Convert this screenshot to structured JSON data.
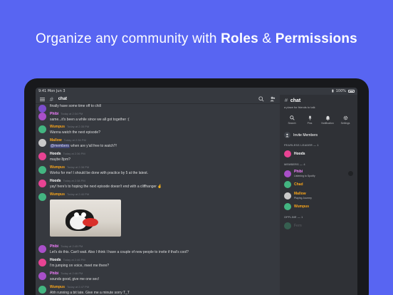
{
  "headline": {
    "prefix": "Organize any community with ",
    "roles": "Roles",
    "amp": " & ",
    "permissions": "Permissions"
  },
  "status_bar": {
    "time": "9:41",
    "date": "Mon Jun 3",
    "battery": "100%"
  },
  "chat": {
    "channel": "chat",
    "messages": [
      {
        "author": "",
        "color": "#dcddde",
        "timestamp": "",
        "lines": [
          "finally have some time off to chill"
        ]
      },
      {
        "author": "Phibi",
        "color": "#f47fff",
        "timestamp": "Today at 2:34 PM",
        "lines": [
          "same...it's been a while since we all got together :("
        ]
      },
      {
        "author": "Wumpus",
        "color": "#faa61a",
        "timestamp": "Today at 2:35 PM",
        "lines": [
          "Wanna watch the next episode?"
        ]
      },
      {
        "author": "Mallow",
        "color": "#faa61a",
        "timestamp": "Today at 2:36 PM",
        "mention": "@members",
        "lines": [
          " when are y'all free to watch?!"
        ]
      },
      {
        "author": "Hoods",
        "color": "#ffffff",
        "timestamp": "Today at 2:36 PM",
        "lines": [
          "maybe 8pm?"
        ]
      },
      {
        "author": "Wumpus",
        "color": "#faa61a",
        "timestamp": "Today at 2:38 PM",
        "lines": [
          "Works for me! I should be done with practice by 5 at the latest."
        ]
      },
      {
        "author": "Hoods",
        "color": "#ffffff",
        "timestamp": "Today at 2:38 PM",
        "lines": [
          "yay! here's to hoping the next episode doesn't end with a cliffhanger 🤞"
        ]
      },
      {
        "author": "Wumpus",
        "color": "#faa61a",
        "timestamp": "Today at 2:40 PM",
        "lines": []
      },
      {
        "author": "Phibi",
        "color": "#f47fff",
        "timestamp": "Today at 2:45 PM",
        "lines": [
          "Let's do this. Can't wait. Also I think I have a couple of new people to invite if that's cool?"
        ]
      },
      {
        "author": "Hoods",
        "color": "#ffffff",
        "timestamp": "Today at 2:46 PM",
        "lines": [
          "I'm jumping on voice, meet me there?"
        ]
      },
      {
        "author": "Phibi",
        "color": "#f47fff",
        "timestamp": "Today at 2:46 PM",
        "lines": [
          "sounds good, give me one sec!"
        ]
      },
      {
        "author": "Wumpus",
        "color": "#faa61a",
        "timestamp": "Today at 2:47 PM",
        "lines": [
          "Ahh running a bit late. Give me a minute sorry T_T"
        ]
      }
    ]
  },
  "side": {
    "channel": "chat",
    "topic": "a place for friends to talk",
    "actions": [
      {
        "label": "Search",
        "icon": "search-icon"
      },
      {
        "label": "Pins",
        "icon": "pin-icon"
      },
      {
        "label": "Notification",
        "icon": "bell-icon"
      },
      {
        "label": "Settings",
        "icon": "gear-icon"
      }
    ],
    "invite_label": "Invite Members",
    "sections": [
      {
        "title": "FEARLESS LEADER — 1",
        "members": [
          {
            "name": "Hoods",
            "color": "#ffffff",
            "status": ""
          }
        ]
      },
      {
        "title": "MEMBERS — 4",
        "members": [
          {
            "name": "Phibi",
            "color": "#f47fff",
            "status": "Listening to Spotify"
          },
          {
            "name": "Chad",
            "color": "#faa61a",
            "status": ""
          },
          {
            "name": "Mallow",
            "color": "#faa61a",
            "status": "Playing Journey"
          },
          {
            "name": "Wumpus",
            "color": "#faa61a",
            "status": ""
          }
        ]
      },
      {
        "title": "OFFLINE — 1",
        "members": [
          {
            "name": "Fern",
            "color": "#8e9297",
            "status": ""
          }
        ]
      }
    ]
  },
  "colors": {
    "blurple": "#5865f2",
    "chat_bg": "#36393f",
    "side_bg": "#2f3136"
  }
}
